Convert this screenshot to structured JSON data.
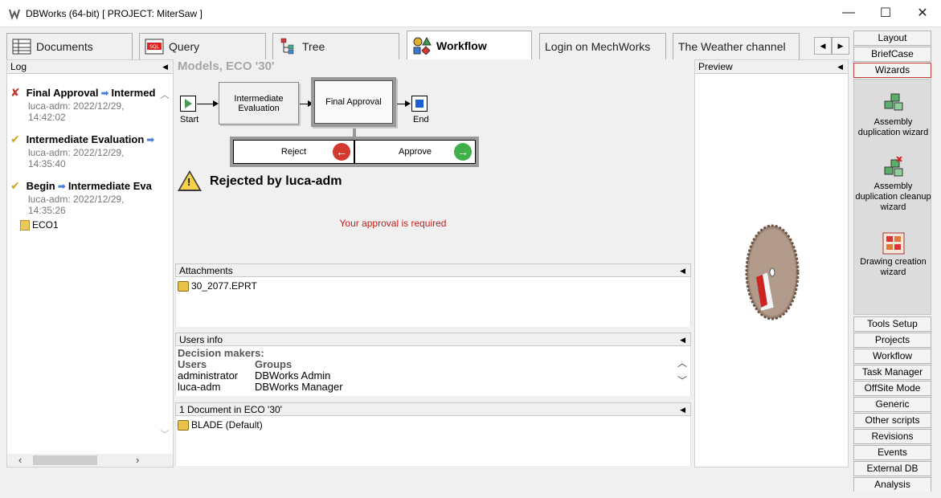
{
  "window": {
    "title": "DBWorks (64-bit) [ PROJECT: MiterSaw ]",
    "minimize_glyph": "—",
    "maximize_glyph": "☐",
    "close_glyph": "✕"
  },
  "tabs": [
    {
      "label": "Documents",
      "icon": "documents-table-icon"
    },
    {
      "label": "Query",
      "icon": "query-icon"
    },
    {
      "label": "Tree",
      "icon": "tree-icon"
    },
    {
      "label": "Workflow",
      "icon": "workflow-shapes-icon"
    },
    {
      "label": "Login on MechWorks",
      "icon": ""
    },
    {
      "label": "The Weather channel",
      "icon": ""
    }
  ],
  "log": {
    "header": "Log",
    "entries": [
      {
        "status": "rejected",
        "from": "Final Approval",
        "to": "Intermed",
        "meta1": "luca-adm: 2022/12/29,",
        "meta2": "14:42:02"
      },
      {
        "status": "approved",
        "from": "Intermediate Evaluation",
        "to": "",
        "meta1": "luca-adm: 2022/12/29,",
        "meta2": "14:35:40"
      },
      {
        "status": "approved",
        "from": "Begin",
        "to": "Intermediate Eva",
        "meta1": "luca-adm: 2022/12/29,",
        "meta2": "14:35:26"
      }
    ],
    "folder": "ECO1"
  },
  "main": {
    "title": "Models, ECO '30'",
    "workflow": {
      "start_label": "Start",
      "end_label": "End",
      "node1": "Intermediate Evaluation",
      "node2": "Final Approval"
    },
    "decision": {
      "reject": "Reject",
      "approve": "Approve"
    },
    "status_text": "Rejected by luca-adm",
    "approval_msg": "Your approval is required",
    "attachments": {
      "header": "Attachments",
      "items": [
        "30_2077.EPRT"
      ]
    },
    "users_info": {
      "header": "Users info",
      "decision_makers": "Decision makers:",
      "col_users": "Users",
      "col_groups": "Groups",
      "rows": [
        {
          "user": "administrator",
          "group": "DBWorks Admin"
        },
        {
          "user": "luca-adm",
          "group": "DBWorks Manager"
        }
      ]
    },
    "documents": {
      "header": "1 Document in ECO '30'",
      "items": [
        "BLADE (Default)"
      ]
    }
  },
  "preview": {
    "header": "Preview"
  },
  "rightbar": {
    "top_buttons": [
      "Layout",
      "BriefCase",
      "Wizards"
    ],
    "wizards": [
      "Assembly duplication wizard",
      "Assembly duplication cleanup wizard",
      "Drawing creation wizard"
    ],
    "bottom_buttons": [
      "Tools Setup",
      "Projects",
      "Workflow",
      "Task Manager",
      "OffSite Mode",
      "Generic",
      "Other scripts",
      "Revisions",
      "Events",
      "External DB",
      "Analysis"
    ]
  },
  "colors": {
    "reject": "#d23a2f",
    "approve": "#3fb04a",
    "error_text": "#c81e1e",
    "selected_border": "#c43838"
  }
}
